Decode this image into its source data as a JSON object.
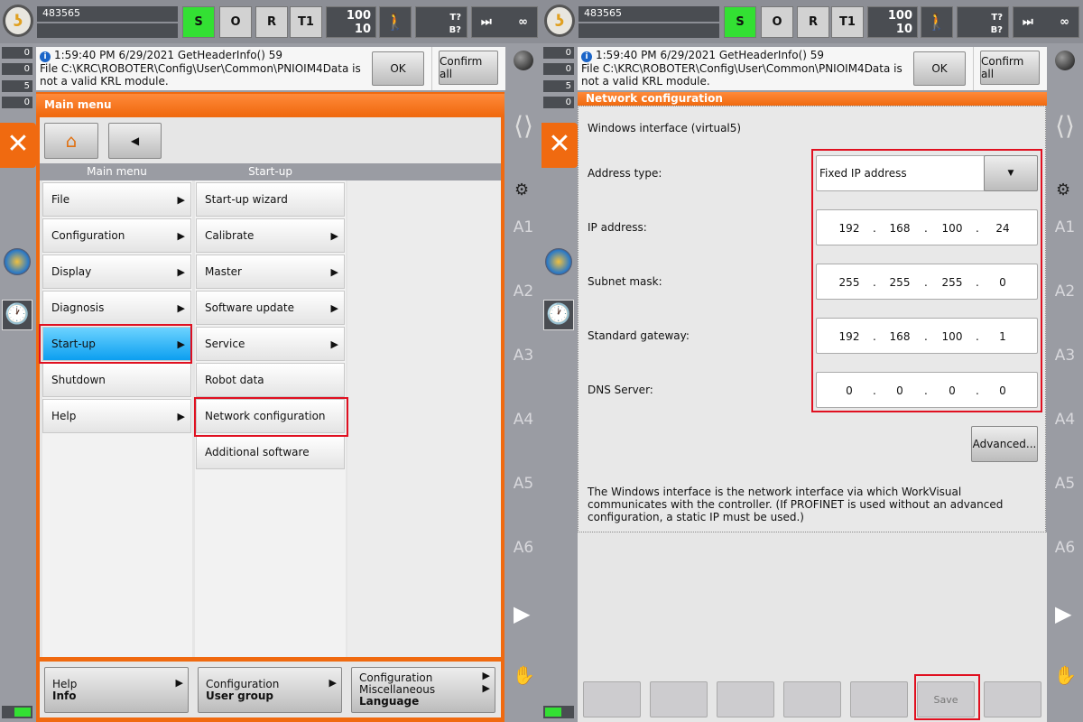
{
  "header": {
    "robot_name": "483565",
    "buttons": [
      "S",
      "O",
      "R",
      "T1"
    ],
    "override_prog": "100",
    "override_jog": "10",
    "tool_label_t": "T?",
    "tool_label_b": "B?",
    "increment": "∞",
    "colors": {
      "s_active": "#33e033",
      "accent": "#f06a10",
      "highlight": "#e01020"
    }
  },
  "message": {
    "timestamp": "1:59:40 PM 6/29/2021 GetHeaderInfo() 59",
    "text": "File C:\\KRC\\ROBOTER\\Config\\User\\Common\\PNIOIM4Data is not a valid KRL module.",
    "ok": "OK",
    "confirm_all": "Confirm all"
  },
  "counters": [
    "0",
    "0",
    "5",
    "0"
  ],
  "axes": [
    "A1",
    "A2",
    "A3",
    "A4",
    "A5",
    "A6"
  ],
  "left": {
    "title": "Main menu",
    "col1_header": "Main menu",
    "col2_header": "Start-up",
    "col1": [
      {
        "label": "File",
        "sub": true
      },
      {
        "label": "Configuration",
        "sub": true
      },
      {
        "label": "Display",
        "sub": true
      },
      {
        "label": "Diagnosis",
        "sub": true
      },
      {
        "label": "Start-up",
        "sub": true,
        "selected": true
      },
      {
        "label": "Shutdown",
        "sub": false
      },
      {
        "label": "Help",
        "sub": true
      }
    ],
    "col2": [
      {
        "label": "Start-up wizard",
        "sub": false
      },
      {
        "label": "Calibrate",
        "sub": true
      },
      {
        "label": "Master",
        "sub": true
      },
      {
        "label": "Software update",
        "sub": true
      },
      {
        "label": "Service",
        "sub": true
      },
      {
        "label": "Robot data",
        "sub": false
      },
      {
        "label": "Network configuration",
        "sub": false,
        "highlighted": true
      },
      {
        "label": "Additional software",
        "sub": false
      }
    ],
    "recent": [
      {
        "line1": "Help",
        "bold": "Info"
      },
      {
        "line1": "Configuration",
        "bold": "User group"
      },
      {
        "line1": "Configuration",
        "line2": "Miscellaneous",
        "bold": "Language"
      }
    ]
  },
  "right": {
    "title": "Network configuration",
    "interface": "Windows interface (virtual5)",
    "address_type_label": "Address type:",
    "address_type_value": "Fixed IP address",
    "fields": [
      {
        "label": "IP address:",
        "octets": [
          "192",
          "168",
          "100",
          "24"
        ]
      },
      {
        "label": "Subnet mask:",
        "octets": [
          "255",
          "255",
          "255",
          "0"
        ]
      },
      {
        "label": "Standard gateway:",
        "octets": [
          "192",
          "168",
          "100",
          "1"
        ]
      },
      {
        "label": "DNS Server:",
        "octets": [
          "0",
          "0",
          "0",
          "0"
        ]
      }
    ],
    "advanced": "Advanced...",
    "note": "The Windows interface is the network interface via which WorkVisual communicates with the controller. (If PROFINET is used without an advanced configuration, a static IP must be used.)",
    "softkeys": [
      "",
      "",
      "",
      "",
      "",
      "Save",
      ""
    ]
  }
}
